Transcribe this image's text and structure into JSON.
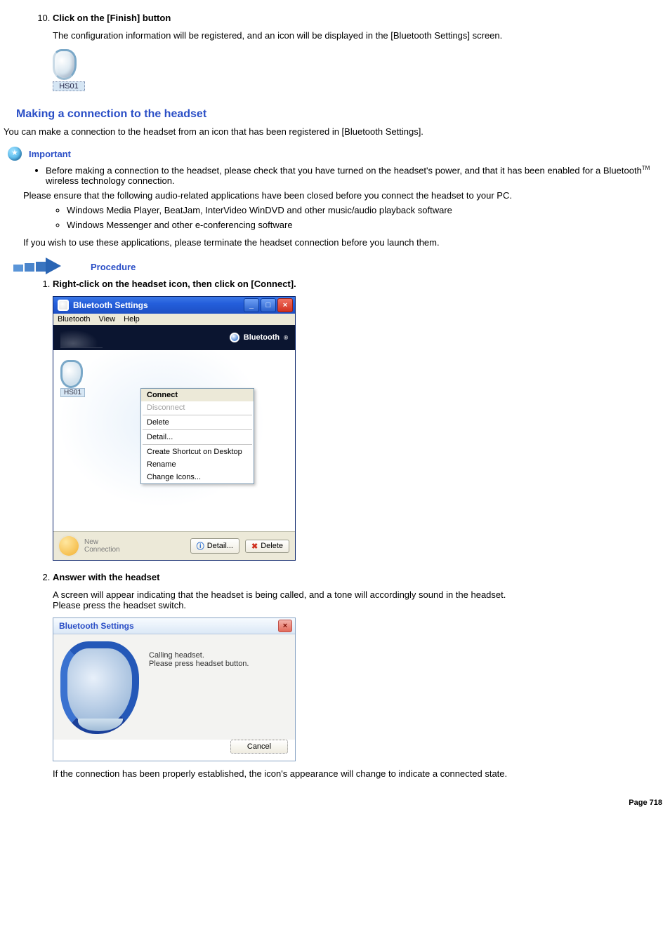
{
  "step10": {
    "number": "10.",
    "title": "Click on the [Finish] button",
    "body": "The configuration information will be registered, and an icon will be displayed in the [Bluetooth Settings] screen.",
    "icon_label": "HS01"
  },
  "section_heading": "Making a connection to the headset",
  "section_intro": "You can make a connection to the headset from an icon that has been registered in [Bluetooth Settings].",
  "important": {
    "label": "Important",
    "bullet": "Before making a connection to the headset, please check that you have turned on the headset's power, and that it has been enabled for a Bluetooth™ wireless technology connection.",
    "ensure": "Please ensure that the following audio-related applications have been closed before you connect the headset to your PC.",
    "apps": [
      "Windows Media Player, BeatJam, InterVideo WinDVD and other music/audio playback software",
      "Windows Messenger and other e-conferencing software"
    ],
    "note": "If you wish to use these applications, please terminate the headset connection before you launch them."
  },
  "procedure": {
    "label": "Procedure",
    "step1": {
      "title": "Right-click on the headset icon, then click on [Connect].",
      "window": {
        "title": "Bluetooth Settings",
        "menus": [
          "Bluetooth",
          "View",
          "Help"
        ],
        "brand": "Bluetooth",
        "device_label": "HS01",
        "context_menu": [
          {
            "label": "Connect",
            "state": "selected"
          },
          {
            "label": "Disconnect",
            "state": "disabled"
          },
          {
            "sep": true
          },
          {
            "label": "Delete",
            "state": ""
          },
          {
            "sep": true
          },
          {
            "label": "Detail...",
            "state": ""
          },
          {
            "sep": true
          },
          {
            "label": "Create Shortcut on Desktop",
            "state": ""
          },
          {
            "label": "Rename",
            "state": ""
          },
          {
            "label": "Change Icons...",
            "state": ""
          }
        ],
        "new_conn_line1": "New",
        "new_conn_line2": "Connection",
        "btn_detail": "Detail...",
        "btn_delete": "Delete"
      }
    },
    "step2": {
      "title": "Answer with the headset",
      "body1": "A screen will appear indicating that the headset is being called, and a tone will accordingly sound in the headset.",
      "body2": "Please press the headset switch.",
      "dialog": {
        "title": "Bluetooth Settings",
        "msg_line1": "Calling headset.",
        "msg_line2": "Please press headset button.",
        "cancel": "Cancel"
      },
      "after": "If the connection has been properly established, the icon's appearance will change to indicate a connected state."
    }
  },
  "footer": "Page  718"
}
